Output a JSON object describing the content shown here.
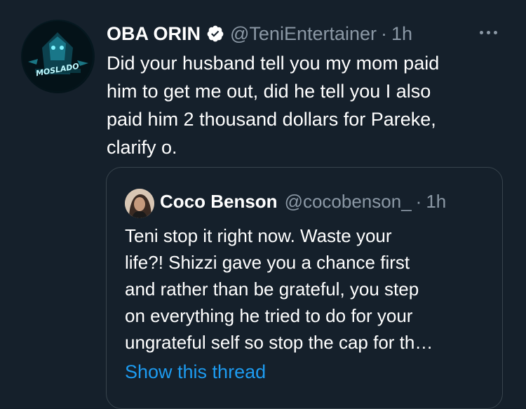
{
  "tweet": {
    "display_name": "OBA ORIN",
    "handle": "@TeniEntertainer",
    "separator": "·",
    "time": "1h",
    "lines": [
      "Did your husband tell you my mom paid",
      "him to get me out, did he tell you I also",
      "paid him 2 thousand dollars for Pareke,",
      "clarify o."
    ],
    "avatar_text": "MOSLADO",
    "icons": {
      "verified": "verified-badge-icon",
      "more": "more-options-icon"
    }
  },
  "quoted_tweet": {
    "display_name": "Coco Benson",
    "handle": "@cocobenson_",
    "separator": "·",
    "time": "1h",
    "lines": [
      "Teni stop it right now. Waste your",
      "life?! Shizzi gave you a chance first",
      "and rather than be grateful, you step",
      "on everything he tried to do for your",
      "ungrateful self so stop the cap for th…"
    ],
    "show_thread_label": "Show this thread"
  },
  "colors": {
    "background": "#15202b",
    "text": "#ffffff",
    "secondary_text": "#8b98a5",
    "link": "#1d9bf0",
    "border": "#38444d"
  }
}
